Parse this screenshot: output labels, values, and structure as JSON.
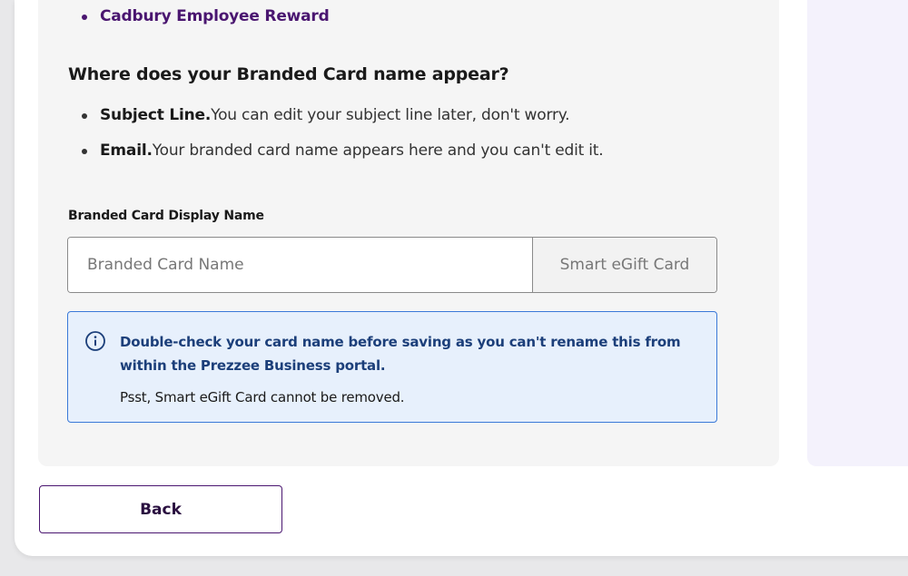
{
  "rewards": {
    "items": [
      "Cadbury Employee Reward"
    ]
  },
  "appearance": {
    "heading": "Where does your Branded Card name appear?",
    "items": [
      {
        "term": "Subject Line.",
        "text": "You can edit your subject line later, don't worry."
      },
      {
        "term": "Email.",
        "text": "Your branded card name appears here and you can't edit it."
      }
    ]
  },
  "display_name": {
    "label": "Branded Card Display Name",
    "placeholder": "Branded Card Name",
    "value": "",
    "suffix": "Smart eGift Card"
  },
  "notice": {
    "icon": "info-icon",
    "title": "Double-check your card name before saving as you can't rename this from within the Prezzee Business portal.",
    "subtitle": "Psst, Smart eGift Card cannot be removed."
  },
  "footer": {
    "back_label": "Back"
  },
  "colors": {
    "brand_purple": "#4a1670",
    "notice_blue": "#3a79d8",
    "notice_background": "#e7f0fc"
  }
}
